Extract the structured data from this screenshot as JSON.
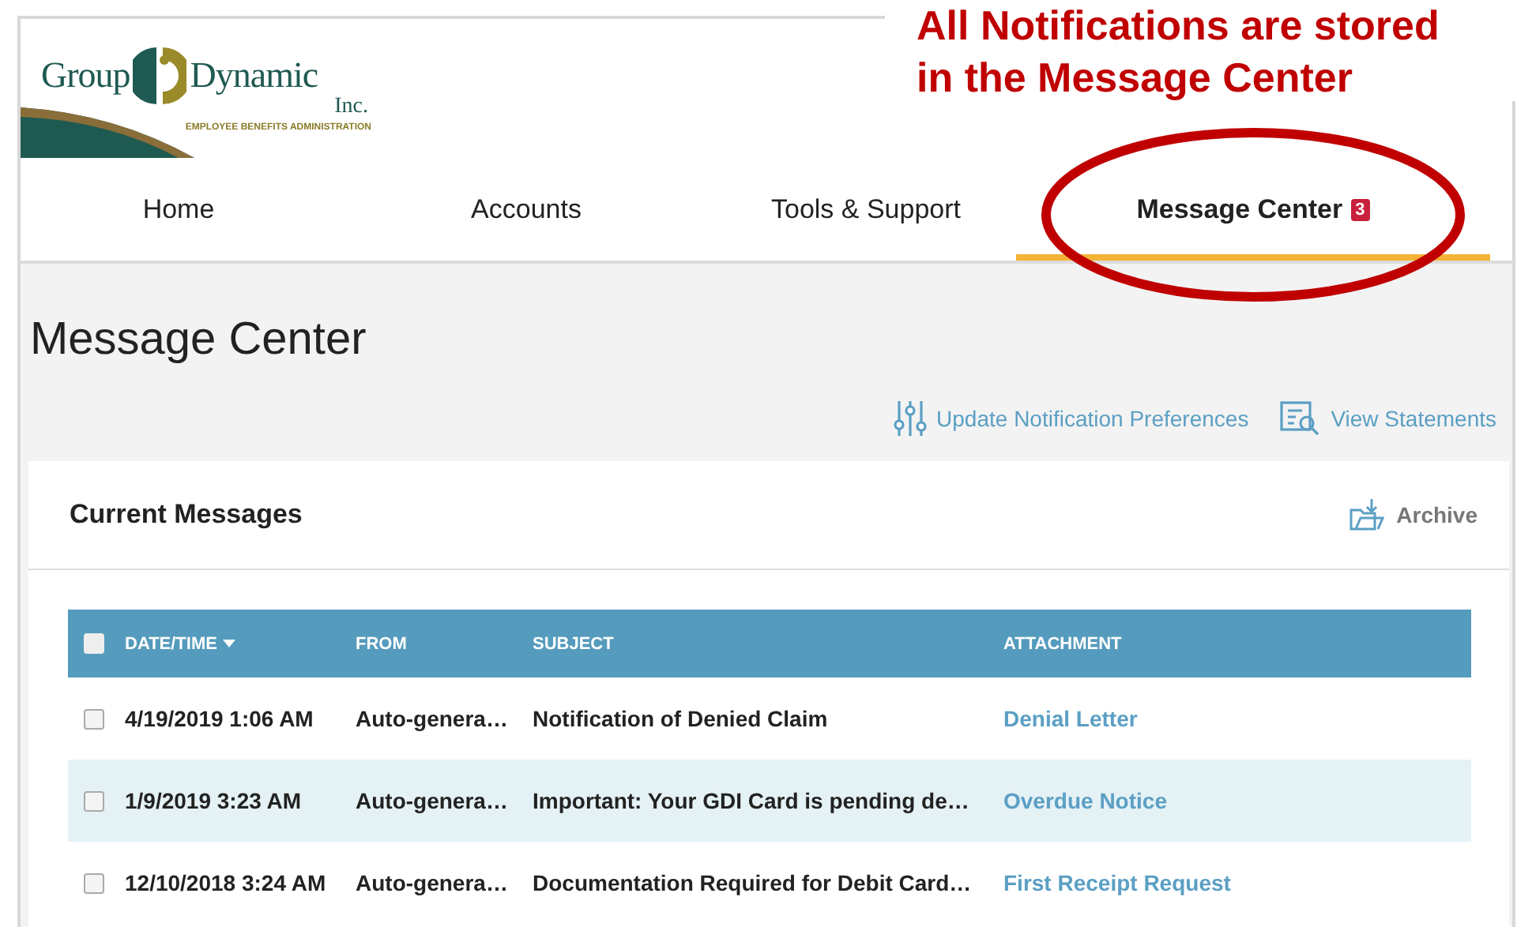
{
  "logo": {
    "word_left": "Group",
    "word_right": "Dynamic",
    "suffix": "Inc.",
    "tagline": "EMPLOYEE BENEFITS ADMINISTRATION"
  },
  "nav": [
    {
      "label": "Home",
      "selected": false
    },
    {
      "label": "Accounts",
      "selected": false
    },
    {
      "label": "Tools & Support",
      "selected": false
    },
    {
      "label": "Message Center",
      "selected": true,
      "badge": "3"
    }
  ],
  "annotation": {
    "lines": [
      "All Notifications are stored",
      "in the Message Center"
    ]
  },
  "page_title": "Message Center",
  "actions": [
    {
      "kind": "preferences",
      "label": "Update Notification Preferences"
    },
    {
      "kind": "statements",
      "label": "View Statements"
    }
  ],
  "card": {
    "title": "Current Messages",
    "archive": "Archive"
  },
  "table": {
    "select_all_checked": false,
    "columns": [
      {
        "label": "DATE/TIME",
        "sorted": true
      },
      {
        "label": "FROM",
        "sorted": false
      },
      {
        "label": "SUBJECT",
        "sorted": false
      },
      {
        "label": "ATTACHMENT",
        "sorted": false
      }
    ],
    "rows": [
      {
        "checked": false,
        "highlighted": false,
        "date": "4/19/2019 1:06 AM",
        "from": "Auto-genera…",
        "subject": "Notification of Denied Claim",
        "attachment": "Denial Letter"
      },
      {
        "checked": false,
        "highlighted": true,
        "date": "1/9/2019 3:23 AM",
        "from": "Auto-genera…",
        "subject": "Important: Your GDI Card is pending de…",
        "attachment": "Overdue Notice"
      },
      {
        "checked": false,
        "highlighted": false,
        "date": "12/10/2018 3:24 AM",
        "from": "Auto-genera…",
        "subject": "Documentation Required for Debit Card…",
        "attachment": "First Receipt Request"
      }
    ]
  }
}
